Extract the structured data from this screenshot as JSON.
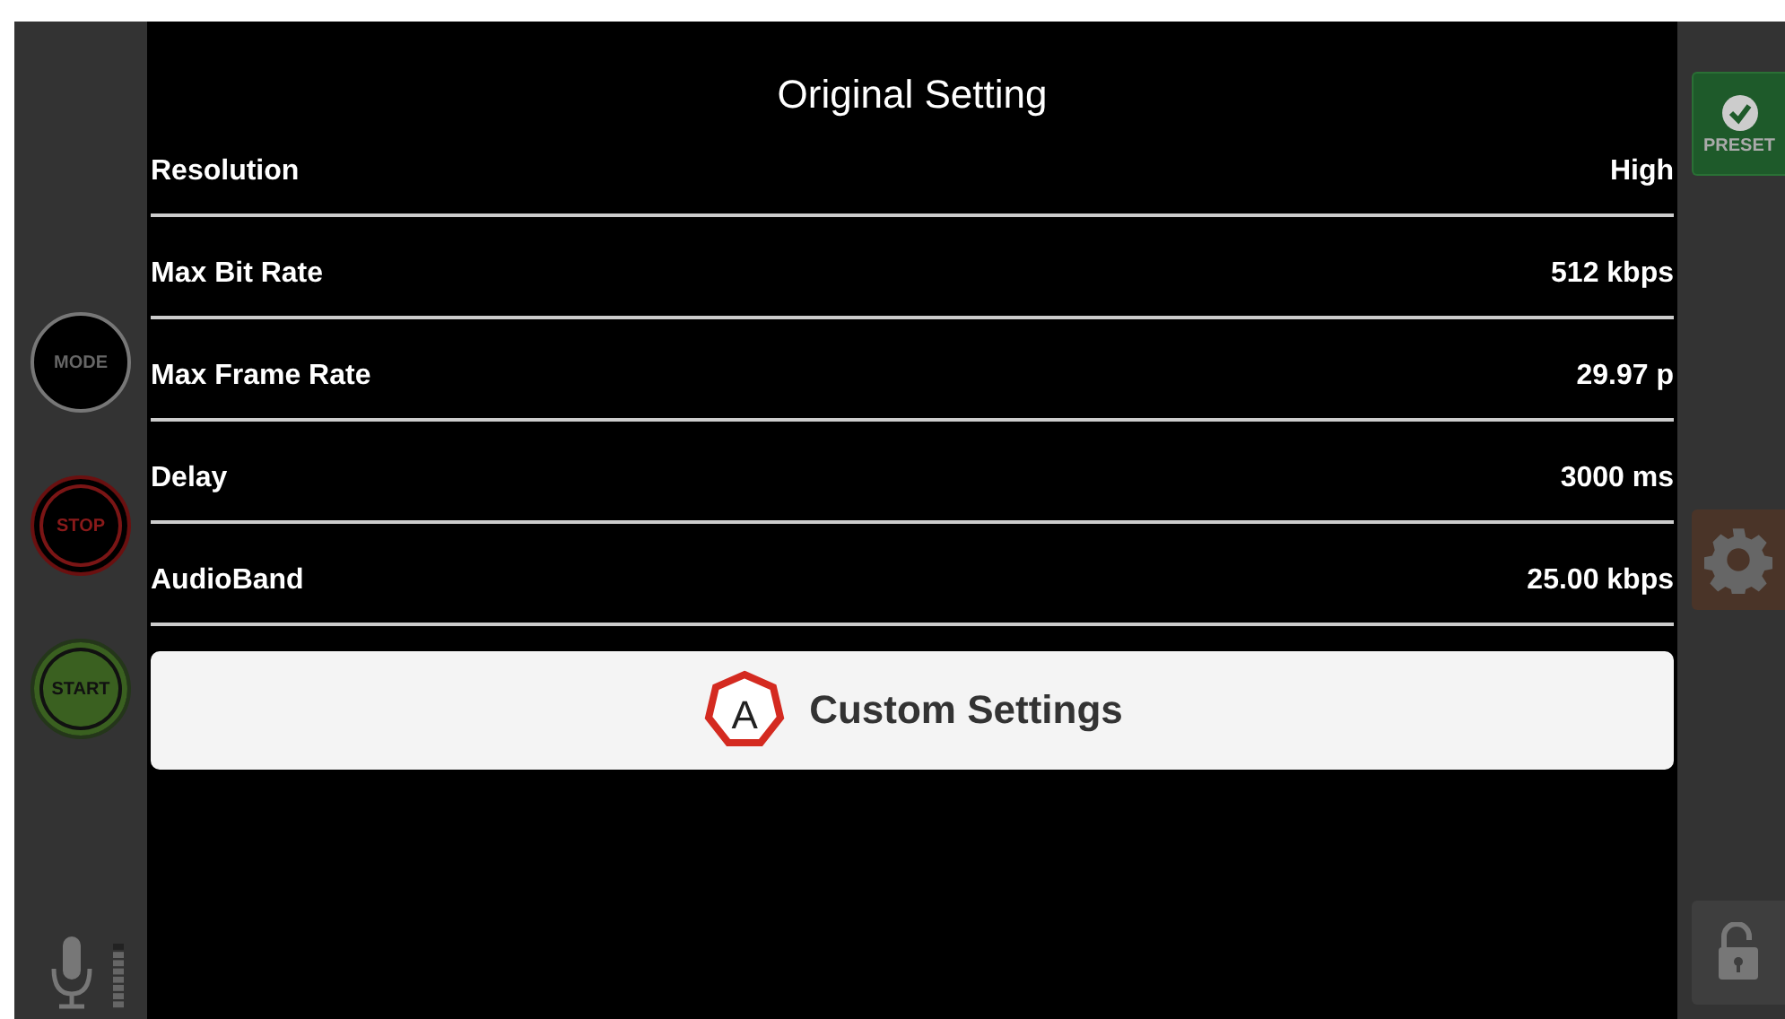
{
  "title": "Original Setting",
  "left_controls": [
    {
      "label": "MODE",
      "kind": "mode"
    },
    {
      "label": "STOP",
      "kind": "stop"
    },
    {
      "label": "START",
      "kind": "start"
    }
  ],
  "settings": [
    {
      "label": "Resolution",
      "value": "High"
    },
    {
      "label": "Max Bit Rate",
      "value": "512 kbps"
    },
    {
      "label": "Max Frame Rate",
      "value": "29.97 p"
    },
    {
      "label": "Delay",
      "value": "3000 ms"
    },
    {
      "label": "AudioBand",
      "value": "25.00 kbps"
    }
  ],
  "custom_button": {
    "label": "Custom Settings",
    "callout": "A"
  },
  "right_controls": {
    "preset_label": "PRESET",
    "settings_disabled": true
  }
}
